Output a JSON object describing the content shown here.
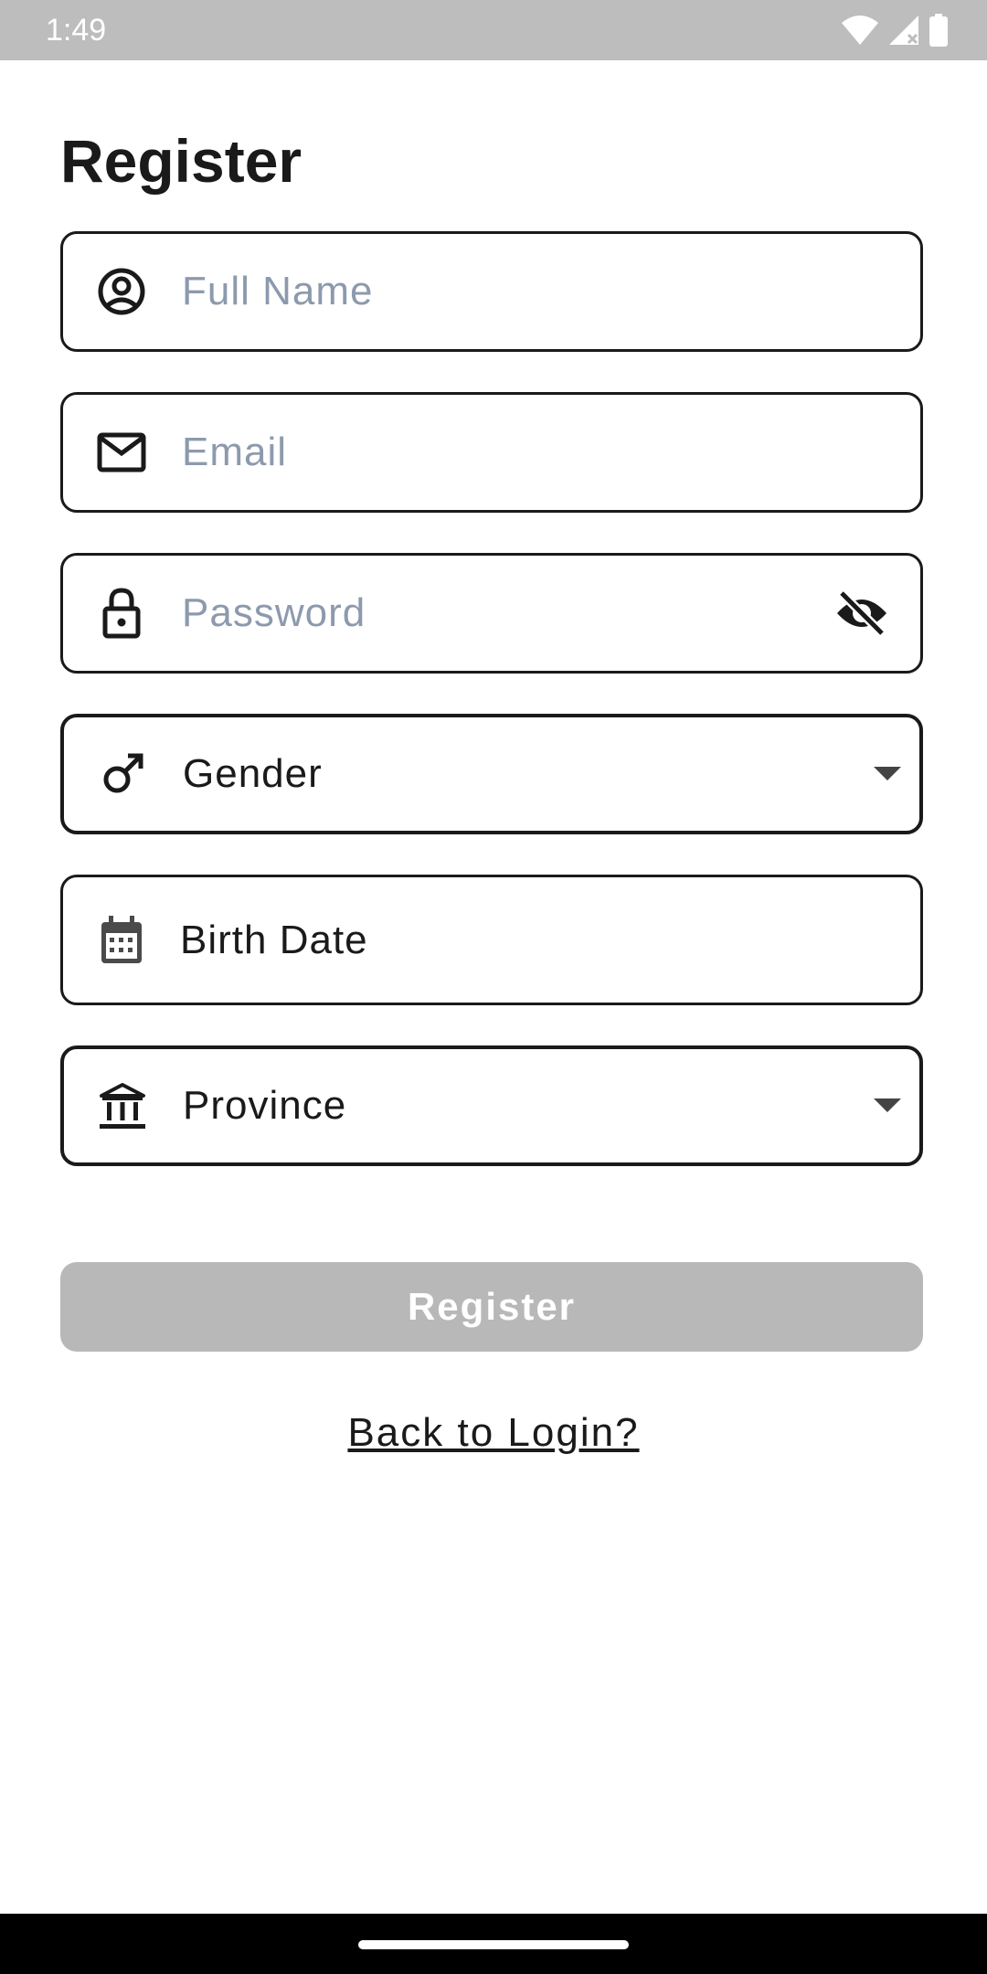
{
  "status_bar": {
    "time": "1:49",
    "icons": [
      "wifi-icon",
      "cellular-signal-icon",
      "battery-icon"
    ]
  },
  "page": {
    "title": "Register"
  },
  "form": {
    "full_name": {
      "placeholder": "Full Name",
      "value": "",
      "icon": "account-circle-icon"
    },
    "email": {
      "placeholder": "Email",
      "value": "",
      "icon": "mail-icon"
    },
    "password": {
      "placeholder": "Password",
      "value": "",
      "icon": "lock-icon",
      "toggle_icon": "visibility-off-icon"
    },
    "gender": {
      "label": "Gender",
      "icon": "male-icon",
      "arrow_icon": "dropdown-arrow-icon"
    },
    "birth_date": {
      "label": "Birth Date",
      "icon": "calendar-icon"
    },
    "province": {
      "label": "Province",
      "icon": "bank-building-icon",
      "arrow_icon": "dropdown-arrow-icon"
    }
  },
  "actions": {
    "register_label": "Register",
    "register_enabled": false,
    "back_to_login_label": "Back to Login?"
  },
  "colors": {
    "status_bar_bg": "#bdbdbd",
    "border": "#1a1a1a",
    "placeholder": "#8d9aad",
    "button_disabled_bg": "#b8b8b8",
    "button_text": "#ffffff",
    "nav_bar_bg": "#000000"
  }
}
